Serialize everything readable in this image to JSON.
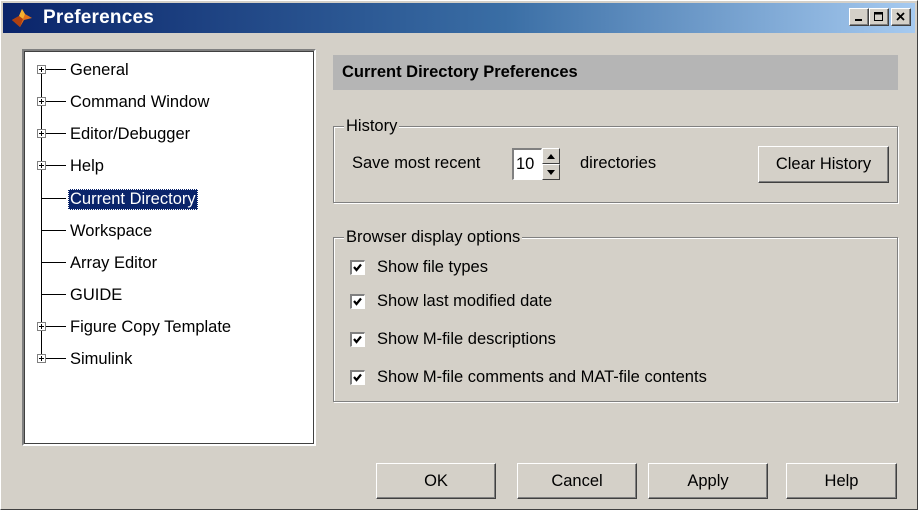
{
  "window": {
    "title": "Preferences",
    "icon": "matlab-logo-icon",
    "controls": [
      "minimize-icon",
      "maximize-icon",
      "close-icon"
    ]
  },
  "tree": {
    "items": [
      {
        "label": "General",
        "expandable": true,
        "selected": false
      },
      {
        "label": "Command Window",
        "expandable": true,
        "selected": false
      },
      {
        "label": "Editor/Debugger",
        "expandable": true,
        "selected": false
      },
      {
        "label": "Help",
        "expandable": true,
        "selected": false
      },
      {
        "label": "Current Directory",
        "expandable": false,
        "selected": true
      },
      {
        "label": "Workspace",
        "expandable": false,
        "selected": false
      },
      {
        "label": "Array Editor",
        "expandable": false,
        "selected": false
      },
      {
        "label": "GUIDE",
        "expandable": false,
        "selected": false
      },
      {
        "label": "Figure Copy Template",
        "expandable": true,
        "selected": false
      },
      {
        "label": "Simulink",
        "expandable": true,
        "selected": false
      }
    ]
  },
  "panel": {
    "title": "Current Directory Preferences",
    "history": {
      "group_label": "History",
      "prefix": "Save most recent",
      "value": "10",
      "suffix": "directories",
      "clear_button": "Clear History"
    },
    "browser": {
      "group_label": "Browser display options",
      "options": [
        {
          "label": "Show file types",
          "checked": true
        },
        {
          "label": "Show last modified date",
          "checked": true
        },
        {
          "label": "Show M-file descriptions",
          "checked": true
        },
        {
          "label": "Show M-file comments and MAT-file contents",
          "checked": true
        }
      ]
    }
  },
  "buttons": {
    "ok": "OK",
    "cancel": "Cancel",
    "apply": "Apply",
    "help": "Help"
  },
  "colors": {
    "title_gradient_start": "#0a246a",
    "title_gradient_end": "#a6caf0",
    "selection": "#0a246a",
    "dialog_bg": "#d4d0c8",
    "header_bg": "#b5b5b5"
  }
}
